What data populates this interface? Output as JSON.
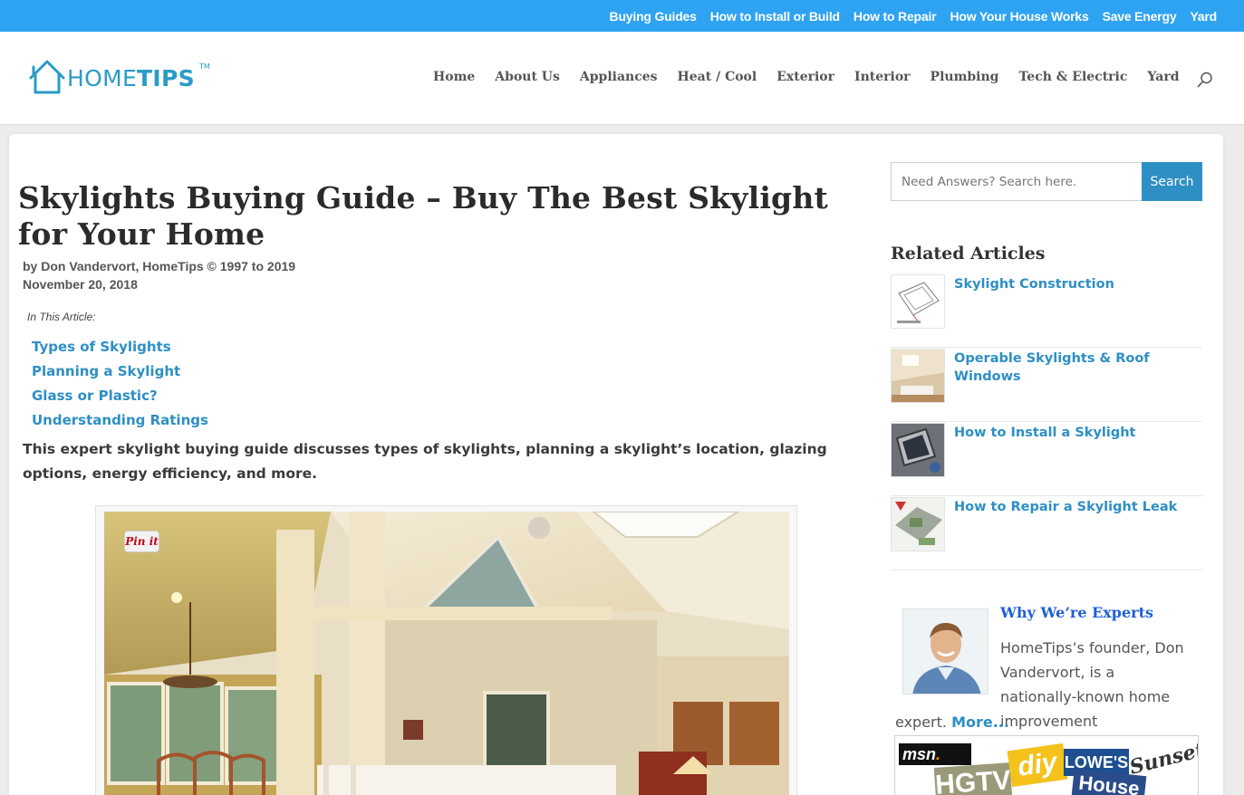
{
  "top_nav": [
    "Buying Guides",
    "How to Install or Build",
    "How to Repair",
    "How Your House Works",
    "Save Energy",
    "Yard"
  ],
  "logo": {
    "part1": "HOME",
    "part2": "TIPS",
    "tm": "TM"
  },
  "main_nav": [
    "Home",
    "About Us",
    "Appliances",
    "Heat / Cool",
    "Exterior",
    "Interior",
    "Plumbing",
    "Tech & Electric",
    "Yard"
  ],
  "article": {
    "title": "Skylights Buying Guide – Buy The Best Skylight for Your Home",
    "byline": "by Don Vandervort, HomeTips © 1997 to 2019",
    "date": "November 20, 2018",
    "toc_label": "In This Article:",
    "toc": [
      "Types of Skylights",
      "Planning a Skylight",
      "Glass or Plastic?",
      "Understanding Ratings"
    ],
    "intro": "This expert skylight buying guide discusses types of skylights, planning a skylight’s location, glazing options, energy efficiency, and more.",
    "pin_label": "Pin it"
  },
  "sidebar": {
    "search_placeholder": "Need Answers? Search here.",
    "search_button": "Search",
    "related_title": "Related Articles",
    "related": [
      "Skylight Construction",
      "Operable Skylights & Roof Windows",
      "How to Install a Skylight",
      "How to Repair a Skylight Leak"
    ],
    "expert_title": "Why We’re Experts",
    "expert_text": "HomeTips’s founder, Don Vandervort, is a nationally-known home improvement",
    "expert_tail": "expert.",
    "expert_more": "More...",
    "media": {
      "msn": "msn",
      "hgtv": "HGTV",
      "diy": "diy",
      "lowes": "LOWE'S",
      "house": "House",
      "sunset": "Sunset"
    }
  }
}
